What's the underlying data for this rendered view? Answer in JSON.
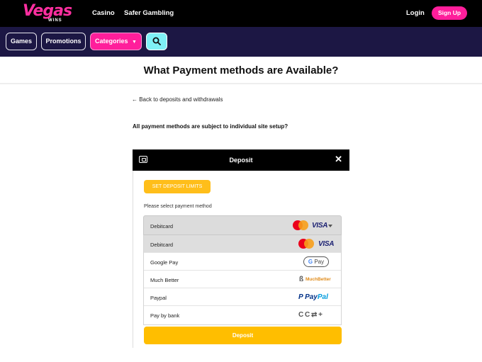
{
  "header": {
    "logo_text": "Vegas",
    "logo_sub": "WINS",
    "nav": [
      "Casino",
      "Safer Gambling"
    ],
    "login_label": "Login",
    "signup_label": "Sign Up"
  },
  "subnav": {
    "games_label": "Games",
    "promotions_label": "Promotions",
    "categories_label": "Categories",
    "categories_caret": "▼",
    "search_icon": "search-icon"
  },
  "page": {
    "title": "What Payment methods are Available?",
    "back_link": "← Back to deposits and withdrawals",
    "notice": "All payment methods are subject to individual site setup?"
  },
  "modal": {
    "title": "Deposit",
    "close_glyph": "✕",
    "wallet_icon": "wallet-icon",
    "limits_button": "SET DEPOSIT LIMITS",
    "select_label": "Please select payment method",
    "selected_value": "Debitcard",
    "options": [
      {
        "label": "Debitcard",
        "logo": "mastercard-visa"
      },
      {
        "label": "Google Pay",
        "logo": "google-pay"
      },
      {
        "label": "Much Better",
        "logo": "muchbetter"
      },
      {
        "label": "Paypal",
        "logo": "paypal"
      },
      {
        "label": "Pay by bank",
        "logo": "bank"
      }
    ],
    "deposit_button": "Deposit",
    "brand_text": {
      "visa": "VISA",
      "gpay_g": "G",
      "gpay_pay": " Pay",
      "muchbetter": "MuchBetter",
      "paypal_a": "Pay",
      "paypal_b": "Pal",
      "bank_glyphs": "C C ⇄ +"
    }
  },
  "colors": {
    "brand_pink": "#ff1e9b",
    "subnav_bg": "#1c1744",
    "search_cyan": "#7ff1f6",
    "deposit_yellow": "#ffbe00"
  }
}
